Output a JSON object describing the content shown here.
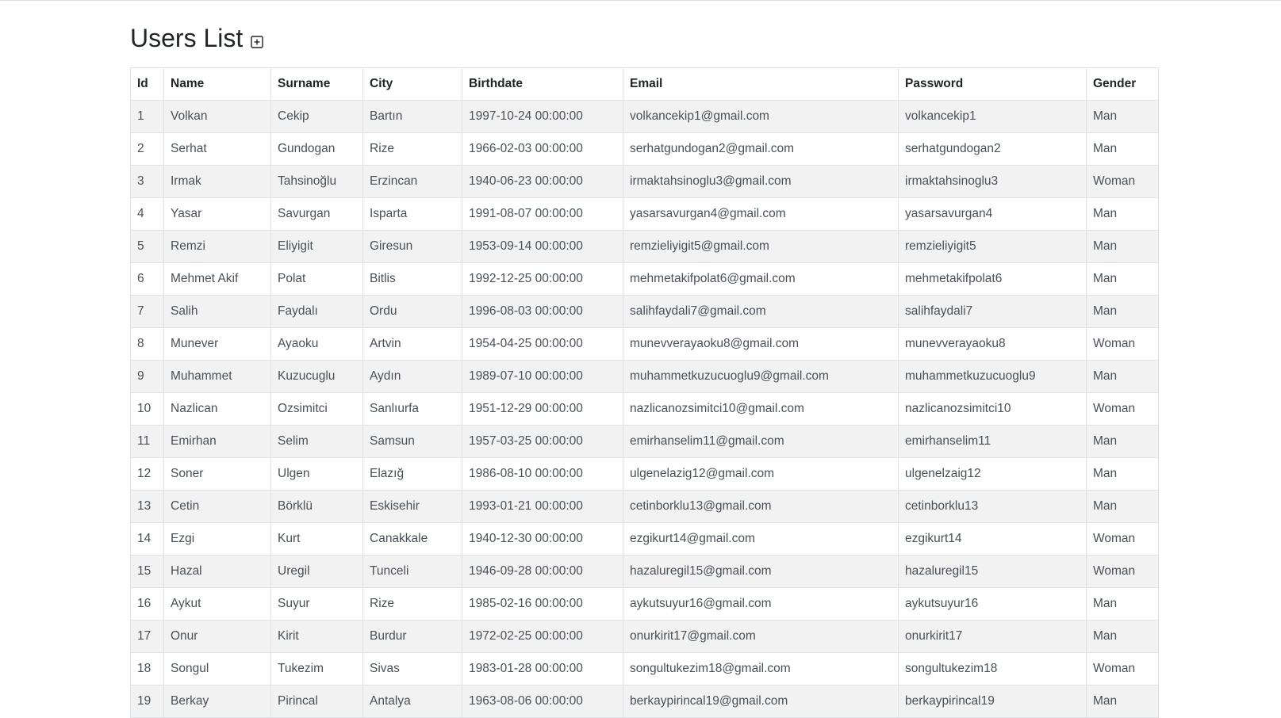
{
  "page": {
    "title": "Users List",
    "add_icon": "plus-square-icon"
  },
  "table": {
    "columns": [
      "Id",
      "Name",
      "Surname",
      "City",
      "Birthdate",
      "Email",
      "Password",
      "Gender"
    ],
    "rows": [
      [
        "1",
        "Volkan",
        "Cekip",
        "Bartın",
        "1997-10-24 00:00:00",
        "volkancekip1@gmail.com",
        "volkancekip1",
        "Man"
      ],
      [
        "2",
        "Serhat",
        "Gundogan",
        "Rize",
        "1966-02-03 00:00:00",
        "serhatgundogan2@gmail.com",
        "serhatgundogan2",
        "Man"
      ],
      [
        "3",
        "Irmak",
        "Tahsinoğlu",
        "Erzincan",
        "1940-06-23 00:00:00",
        "irmaktahsinoglu3@gmail.com",
        "irmaktahsinoglu3",
        "Woman"
      ],
      [
        "4",
        "Yasar",
        "Savurgan",
        "Isparta",
        "1991-08-07 00:00:00",
        "yasarsavurgan4@gmail.com",
        "yasarsavurgan4",
        "Man"
      ],
      [
        "5",
        "Remzi",
        "Eliyigit",
        "Giresun",
        "1953-09-14 00:00:00",
        "remzieliyigit5@gmail.com",
        "remzieliyigit5",
        "Man"
      ],
      [
        "6",
        "Mehmet Akif",
        "Polat",
        "Bitlis",
        "1992-12-25 00:00:00",
        "mehmetakifpolat6@gmail.com",
        "mehmetakifpolat6",
        "Man"
      ],
      [
        "7",
        "Salih",
        "Faydalı",
        "Ordu",
        "1996-08-03 00:00:00",
        "salihfaydali7@gmail.com",
        "salihfaydali7",
        "Man"
      ],
      [
        "8",
        "Munever",
        "Ayaoku",
        "Artvin",
        "1954-04-25 00:00:00",
        "munevverayaoku8@gmail.com",
        "munevverayaoku8",
        "Woman"
      ],
      [
        "9",
        "Muhammet",
        "Kuzucuglu",
        "Aydın",
        "1989-07-10 00:00:00",
        "muhammetkuzucuoglu9@gmail.com",
        "muhammetkuzucuoglu9",
        "Man"
      ],
      [
        "10",
        "Nazlican",
        "Ozsimitci",
        "Sanlıurfa",
        "1951-12-29 00:00:00",
        "nazlicanozsimitci10@gmail.com",
        "nazlicanozsimitci10",
        "Woman"
      ],
      [
        "11",
        "Emirhan",
        "Selim",
        "Samsun",
        "1957-03-25 00:00:00",
        "emirhanselim11@gmail.com",
        "emirhanselim11",
        "Man"
      ],
      [
        "12",
        "Soner",
        "Ulgen",
        "Elazığ",
        "1986-08-10 00:00:00",
        "ulgenelazig12@gmail.com",
        "ulgenelzaig12",
        "Man"
      ],
      [
        "13",
        "Cetin",
        "Börklü",
        "Eskisehir",
        "1993-01-21 00:00:00",
        "cetinborklu13@gmail.com",
        "cetinborklu13",
        "Man"
      ],
      [
        "14",
        "Ezgi",
        "Kurt",
        "Canakkale",
        "1940-12-30 00:00:00",
        "ezgikurt14@gmail.com",
        "ezgikurt14",
        "Woman"
      ],
      [
        "15",
        "Hazal",
        "Uregil",
        "Tunceli",
        "1946-09-28 00:00:00",
        "hazaluregil15@gmail.com",
        "hazaluregil15",
        "Woman"
      ],
      [
        "16",
        "Aykut",
        "Suyur",
        "Rize",
        "1985-02-16 00:00:00",
        "aykutsuyur16@gmail.com",
        "aykutsuyur16",
        "Man"
      ],
      [
        "17",
        "Onur",
        "Kirit",
        "Burdur",
        "1972-02-25 00:00:00",
        "onurkirit17@gmail.com",
        "onurkirit17",
        "Man"
      ],
      [
        "18",
        "Songul",
        "Tukezim",
        "Sivas",
        "1983-01-28 00:00:00",
        "songultukezim18@gmail.com",
        "songultukezim18",
        "Woman"
      ],
      [
        "19",
        "Berkay",
        "Pirincal",
        "Antalya",
        "1963-08-06 00:00:00",
        "berkaypirincal19@gmail.com",
        "berkaypirincal19",
        "Man"
      ]
    ]
  },
  "colors": {
    "stripe": "#f2f2f2",
    "border": "#dee2e6",
    "text": "#212529"
  }
}
